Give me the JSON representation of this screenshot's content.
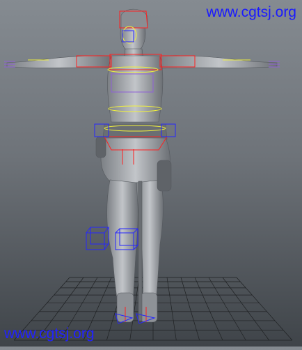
{
  "watermarks": {
    "top": "www.cgtsj.org",
    "bottom": "www.cgtsj.org"
  },
  "viewport": {
    "background_top": "#858b91",
    "background_bottom": "#3f4449",
    "grid_color": "#1e2022",
    "model_color": "#b9bcc0",
    "rig_colors": {
      "joint_red": "#ff2020",
      "control_yellow": "#f2f23a",
      "ik_blue": "#2626ff",
      "finger_purple": "#8f5fd8"
    },
    "icons": [
      "character-model",
      "rig-controls",
      "ground-grid"
    ]
  }
}
